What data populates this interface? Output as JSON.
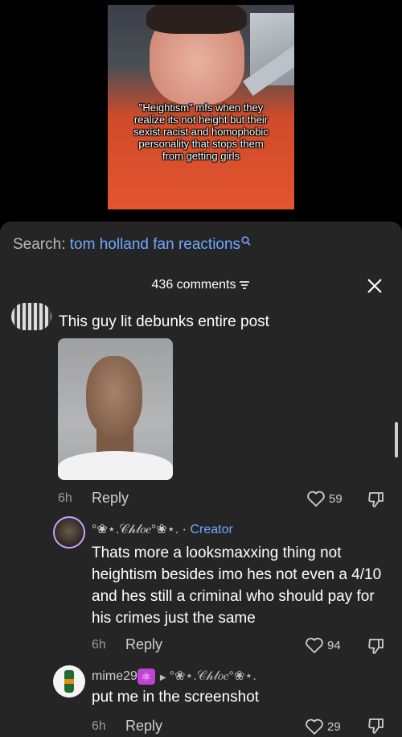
{
  "video": {
    "caption": "\"Heightism\" mfs when they realize its not height but their sexist racist and homophobic personality that stops them from getting girls"
  },
  "search": {
    "prefix": "Search:",
    "query": "tom holland fan reactions"
  },
  "comments_header": {
    "count": "436 comments"
  },
  "comments": [
    {
      "text": "This guy lit debunks entire post",
      "time": "6h",
      "reply": "Reply",
      "likes": "59"
    },
    {
      "author": "°❀⋆.𝒞𝒽𝓁𝑜𝑒°❀⋆.",
      "separator": "·",
      "badge": "Creator",
      "text": "Thats more a looksmaxxing thing not heightism besides imo hes not even a 4/10 and hes still a criminal who should pay for his crimes just the same",
      "time": "6h",
      "reply": "Reply",
      "likes": "94"
    },
    {
      "author": "mime29",
      "badge_emoji": "⚛",
      "reply_to": "°❀⋆.𝒞𝒽𝓁𝑜𝑒°❀⋆.",
      "text": "put me in the screenshot",
      "time": "6h",
      "reply": "Reply",
      "likes": "29"
    }
  ],
  "colors": {
    "accent": "#6ea8ff",
    "sheet": "#252525"
  }
}
